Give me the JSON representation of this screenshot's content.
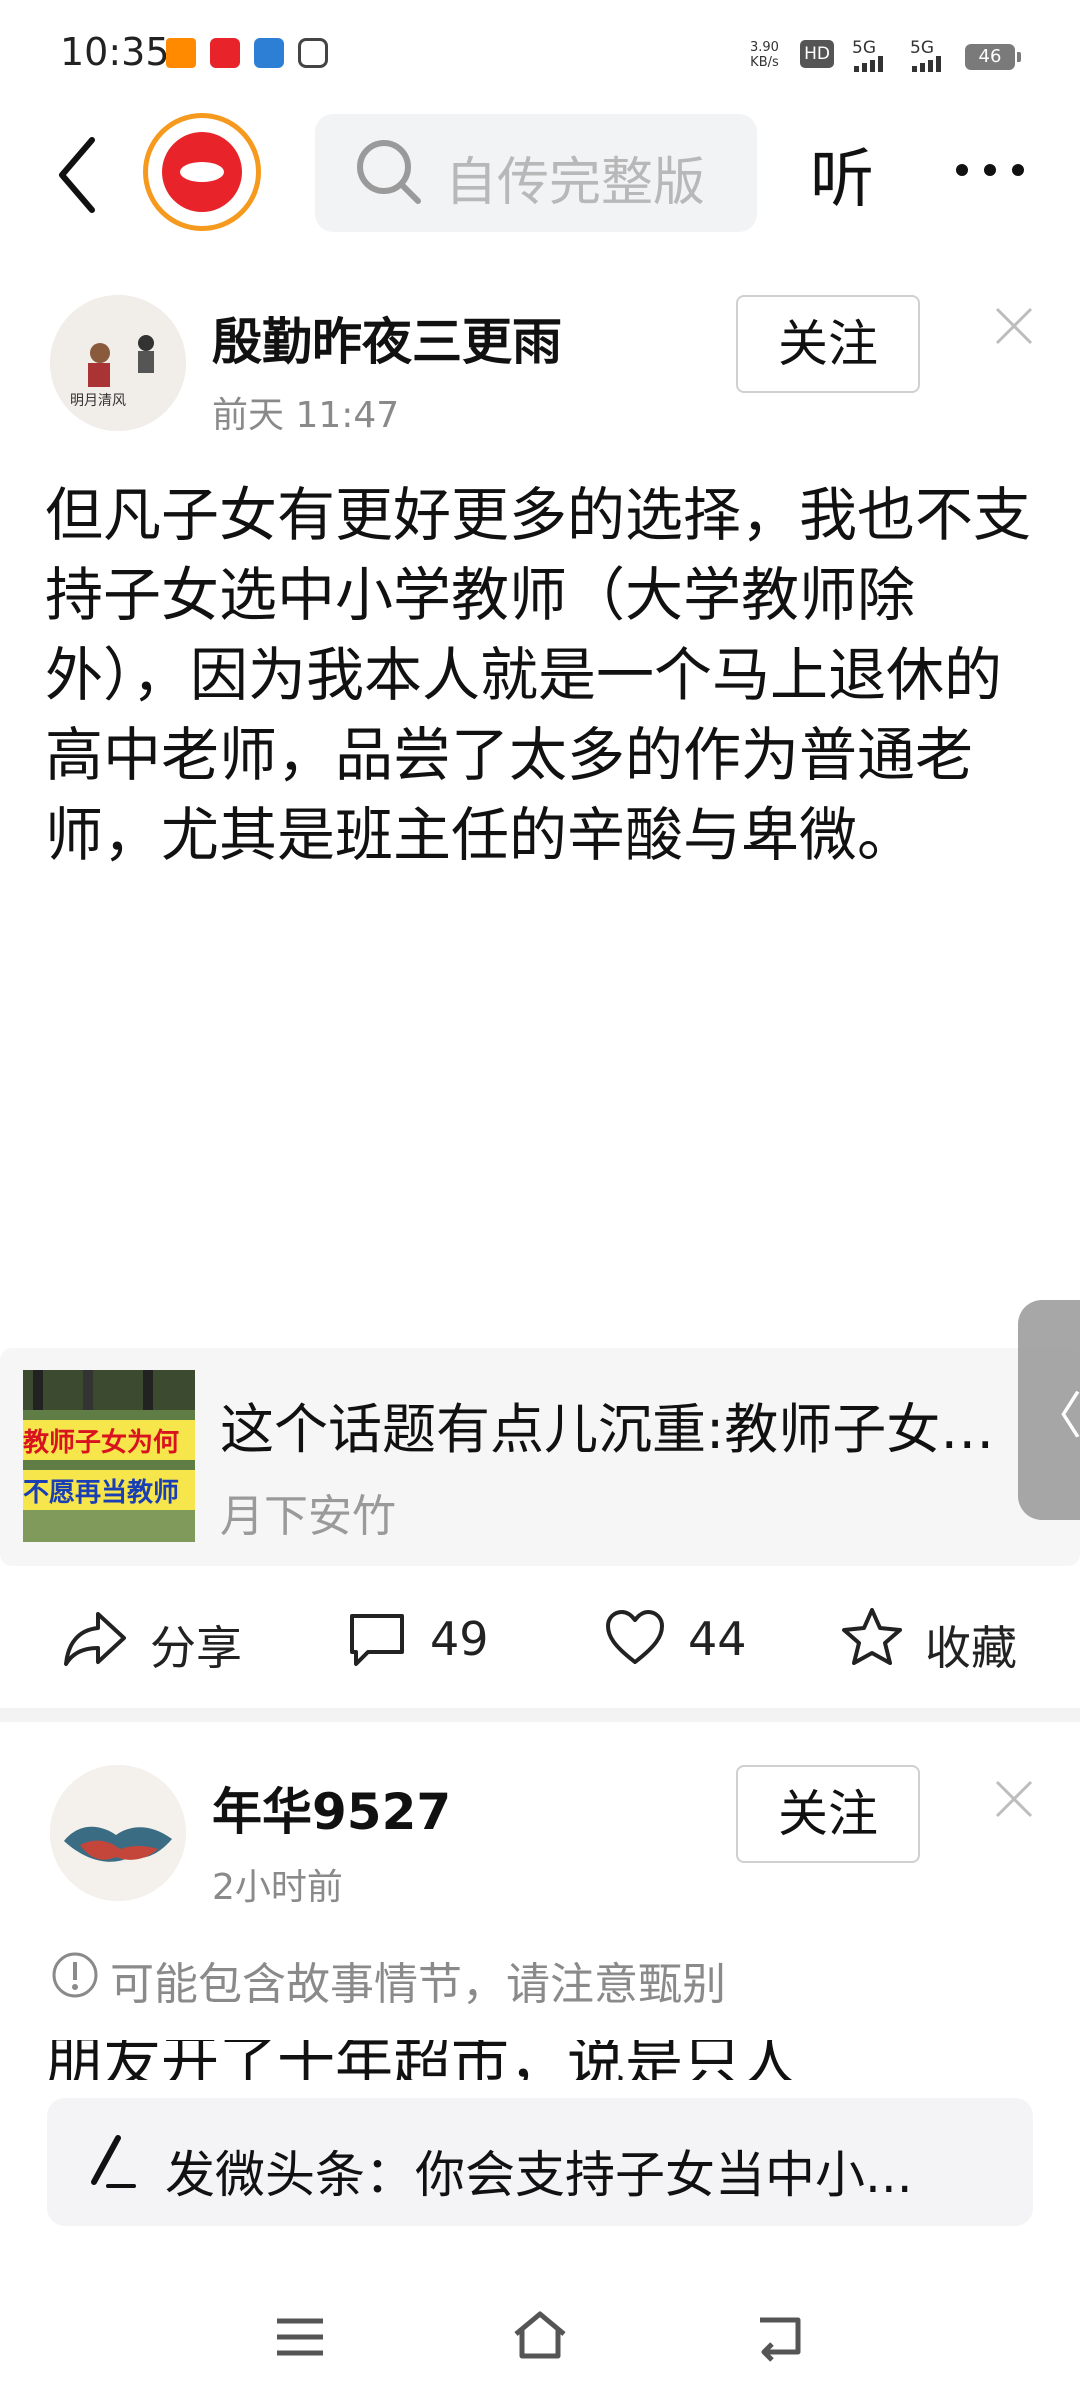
{
  "status_bar": {
    "time": "10:35",
    "speed": "3.90\nKB/s",
    "hd": "HD",
    "net1": "5G",
    "net2": "5G",
    "battery": "46"
  },
  "header": {
    "search_placeholder": "自传完整版",
    "listen_label": "听",
    "accent_color": "#f59a1f",
    "logo_color": "#e8242a"
  },
  "post1": {
    "author": "殷勤昨夜三更雨",
    "time": "前天  11:47",
    "follow_label": "关注",
    "body": "但凡子女有更好更多的选择，我也不支持子女选中小学教师（大学教师除外），因为我本人就是一个马上退休的高中老师，品尝了太多的作为普通老师，尤其是班主任的辛酸与卑微。",
    "article": {
      "title": "这个话题有点儿沉重:教师子女为何不愿再当教师",
      "source": "月下安竹",
      "thumb_line1": "教师子女为何",
      "thumb_line2": "不愿再当教师"
    },
    "actions": {
      "share_label": "分享",
      "comments": "49",
      "likes": "44",
      "favorite_label": "收藏"
    }
  },
  "post2": {
    "author": "年华9527",
    "time": "2小时前",
    "follow_label": "关注",
    "warning": "可能包含故事情节，请注意甄别",
    "body_start": "朋友开了十年超市，说是只人"
  },
  "comment_bar": {
    "text": "发微头条：你会支持子女当中小..."
  },
  "icons": [
    "back-icon",
    "search-icon",
    "more-icon",
    "close-icon",
    "share-icon",
    "comment-icon",
    "heart-icon",
    "star-icon",
    "info-icon",
    "pen-icon",
    "menu-icon",
    "home-icon",
    "back-nav-icon"
  ]
}
